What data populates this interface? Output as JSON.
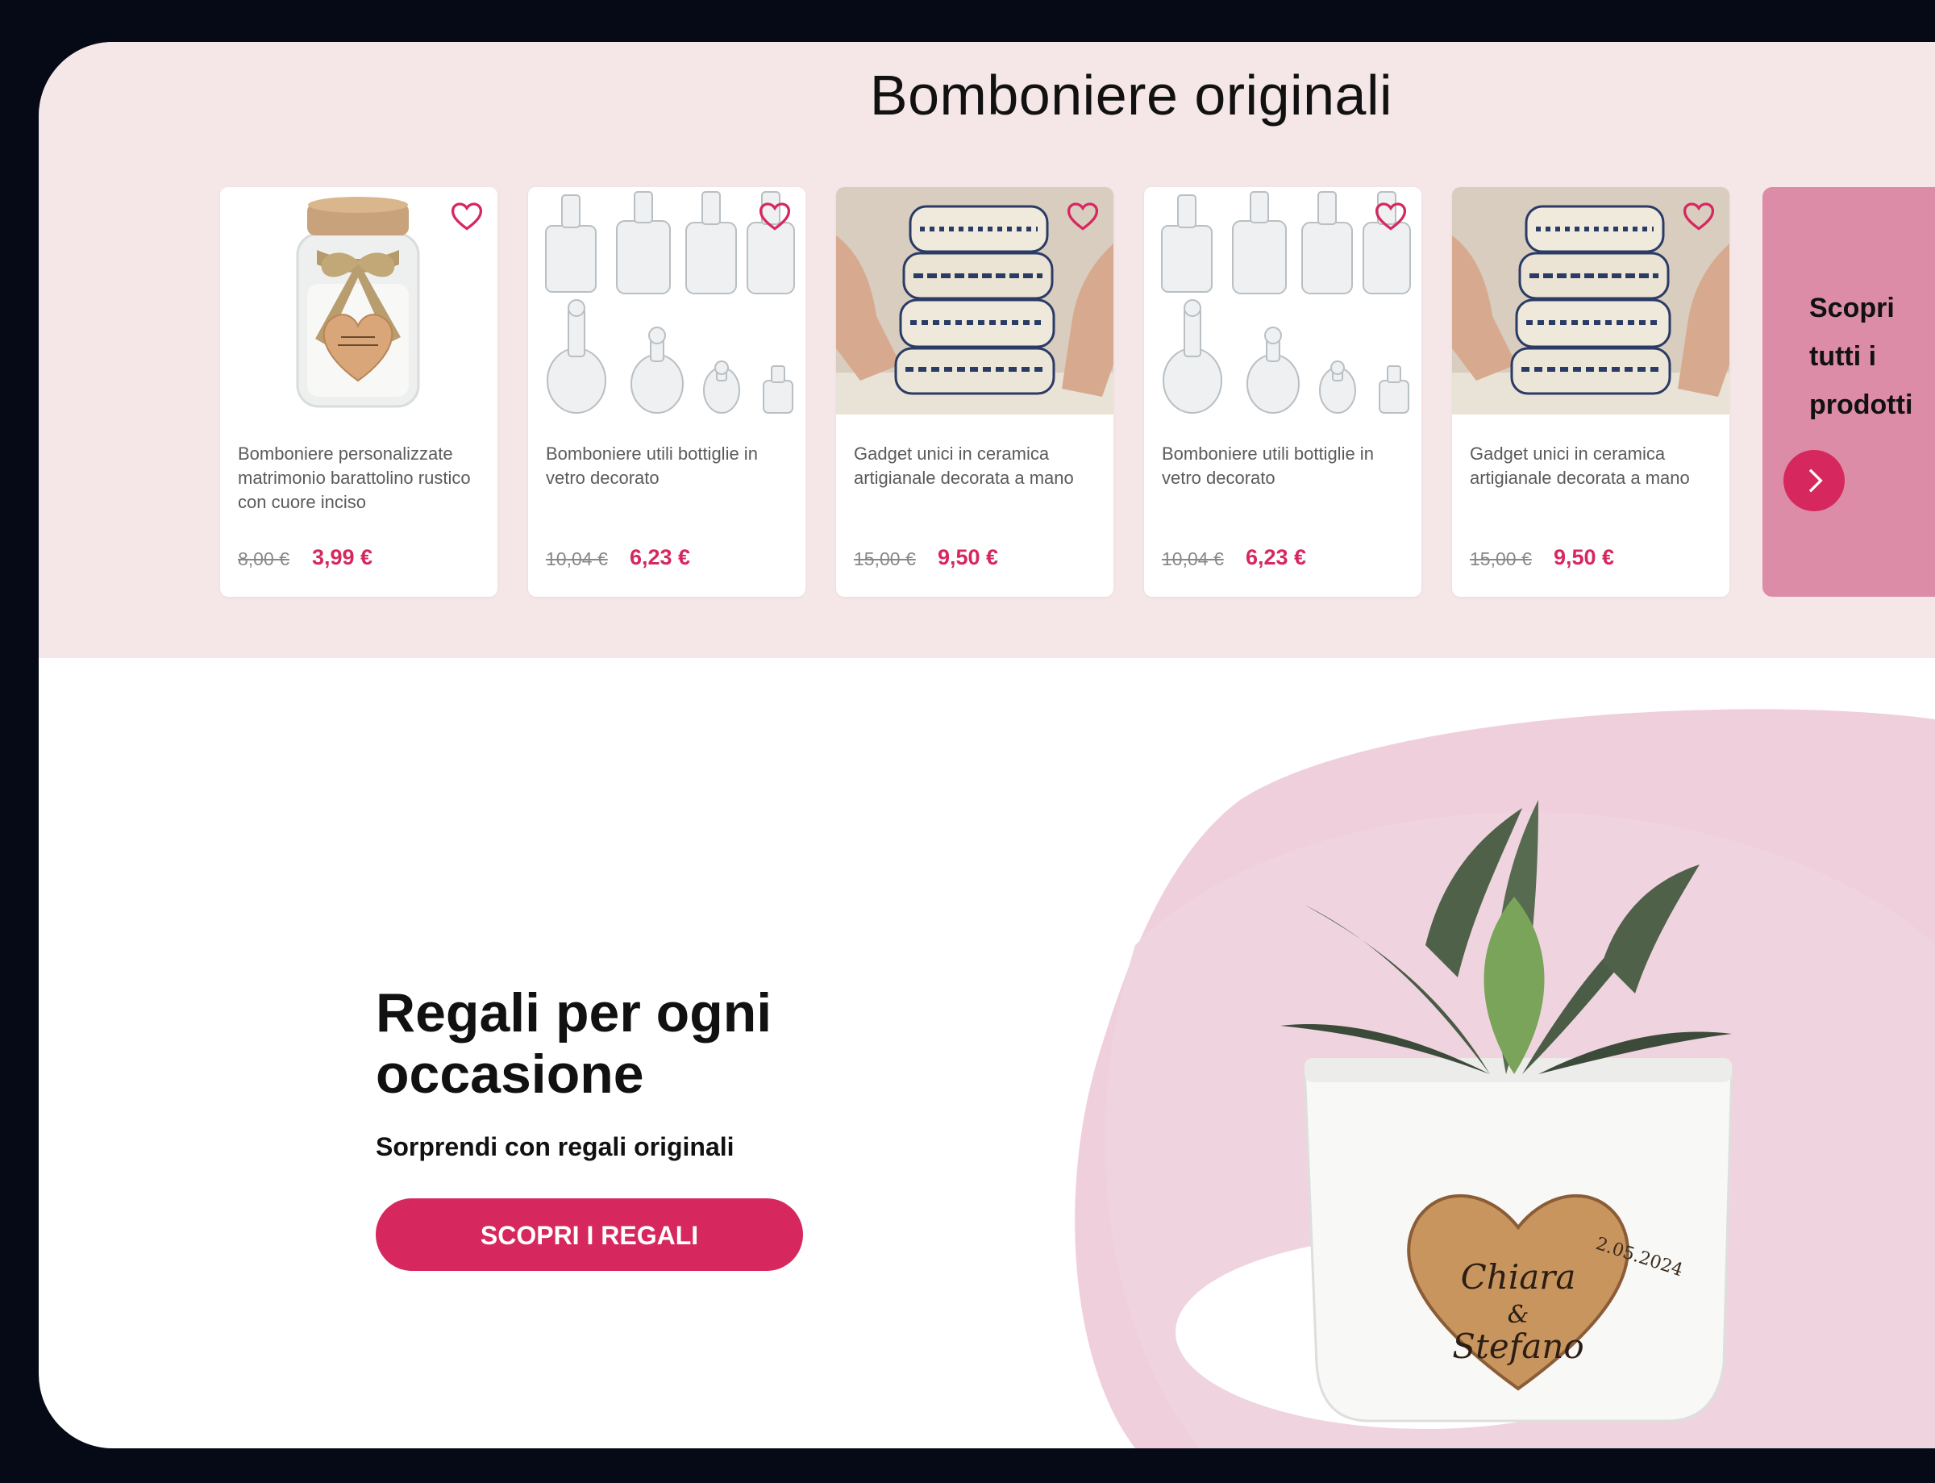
{
  "section_title": "Bomboniere originali",
  "products": [
    {
      "title": "Bomboniere personalizzate matrimonio barattolino rustico con cuore inciso",
      "old_price": "8,00 €",
      "price": "3,99 €",
      "image": "jar-with-wooden-heart",
      "heart_icon": "heart-outline-icon"
    },
    {
      "title": "Bomboniere utili bottiglie in vetro decorato",
      "old_price": "10,04 €",
      "price": "6,23 €",
      "image": "glass-bottles",
      "heart_icon": "heart-outline-icon"
    },
    {
      "title": "Gadget unici in ceramica artigianale decorata a mano",
      "old_price": "15,00 €",
      "price": "9,50 €",
      "image": "ceramic-bowls",
      "heart_icon": "heart-outline-icon"
    },
    {
      "title": "Bomboniere utili bottiglie in vetro decorato",
      "old_price": "10,04 €",
      "price": "6,23 €",
      "image": "glass-bottles",
      "heart_icon": "heart-outline-icon"
    },
    {
      "title": "Gadget unici in ceramica artigianale decorata a mano",
      "old_price": "15,00 €",
      "price": "9,50 €",
      "image": "ceramic-bowls",
      "heart_icon": "heart-outline-icon"
    }
  ],
  "cta_card": {
    "label": "Scopri tutti i prodotti",
    "icon": "chevron-right-icon"
  },
  "promo": {
    "title": "Regali per ogni occasione",
    "subtitle": "Sorprendi con regali originali",
    "button_label": "SCOPRI I REGALI",
    "image_text": {
      "date": "2.05.2024",
      "names": [
        "Chiara",
        "&",
        "Stefano"
      ]
    }
  },
  "colors": {
    "accent": "#d6285f",
    "band_bg": "#f5e7e8",
    "cta_bg": "#dc8ca7",
    "frame": "#050a16"
  }
}
